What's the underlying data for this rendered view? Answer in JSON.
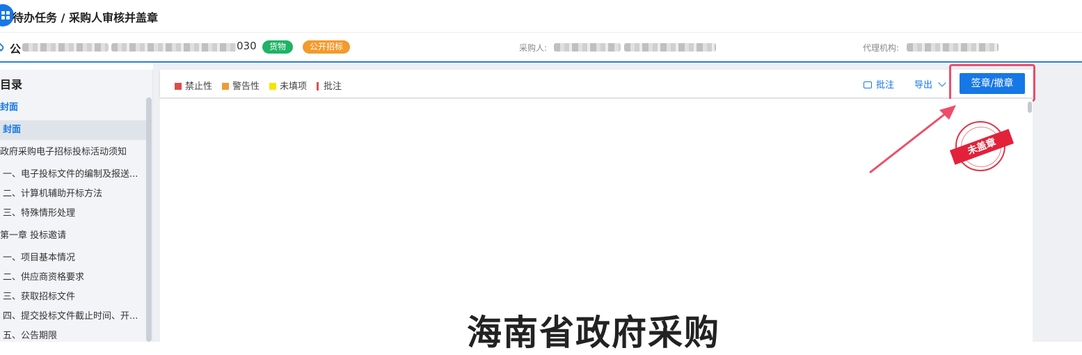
{
  "breadcrumb": "待办任务 / 采购人审核并盖章",
  "project": {
    "name_prefix": "公",
    "code_suffix": "030",
    "tags": {
      "goods": "货物",
      "open_bid": "公开招标"
    },
    "purchaser_label": "采购人:",
    "agency_label": "代理机构:"
  },
  "sidebar": {
    "title": "目录",
    "items": [
      {
        "label": "封面",
        "style": "blue"
      },
      {
        "label": "封面",
        "style": "active"
      },
      {
        "label": "政府采购电子招标投标活动须知"
      },
      {
        "label": "一、电子投标文件的编制及报送..."
      },
      {
        "label": "二、计算机辅助开标方法"
      },
      {
        "label": "三、特殊情形处理"
      },
      {
        "label": "第一章 投标邀请"
      },
      {
        "label": "一、项目基本情况"
      },
      {
        "label": "二、供应商资格要求"
      },
      {
        "label": "三、获取招标文件"
      },
      {
        "label": "四、提交投标文件截止时间、开..."
      },
      {
        "label": "五、公告期限"
      }
    ]
  },
  "toolbar": {
    "legend": [
      {
        "label": "禁止性",
        "color": "#e04b4b"
      },
      {
        "label": "警告性",
        "color": "#f29a38"
      },
      {
        "label": "未填项",
        "color": "#f3e600"
      },
      {
        "label": "批注",
        "color": "#d9534f"
      }
    ],
    "annotate_label": "批注",
    "export_label": "导出",
    "sign_label": "签章/撤章"
  },
  "stamp_label": "未盖章",
  "document": {
    "title": "海南省政府采购"
  },
  "colors": {
    "accent": "#1677e6",
    "highlight": "#ee4d6a",
    "stamp": "#e3213a"
  }
}
